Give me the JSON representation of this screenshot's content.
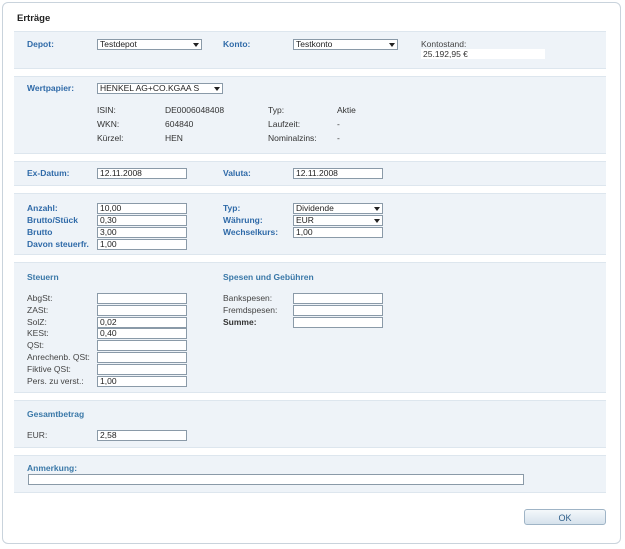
{
  "window": {
    "title": "Erträge"
  },
  "depot": {
    "label": "Depot:",
    "value": "Testdepot"
  },
  "konto": {
    "label": "Konto:",
    "value": "Testkonto"
  },
  "kontostand": {
    "label": "Kontostand:",
    "value": "25.192,95 €"
  },
  "wertpapier": {
    "label": "Wertpapier:",
    "value": "HENKEL AG+CO.KGAA S",
    "isin_label": "ISIN:",
    "isin": "DE0006048408",
    "wkn_label": "WKN:",
    "wkn": "604840",
    "kuerzel_label": "Kürzel:",
    "kuerzel": "HEN",
    "typ_label": "Typ:",
    "typ": "Aktie",
    "laufzeit_label": "Laufzeit:",
    "laufzeit": "-",
    "nominalzins_label": "Nominalzins:",
    "nominalzins": "-"
  },
  "dates": {
    "ex_label": "Ex-Datum:",
    "ex_value": "12.11.2008",
    "valuta_label": "Valuta:",
    "valuta_value": "12.11.2008"
  },
  "amounts": {
    "anzahl_label": "Anzahl:",
    "anzahl": "10,00",
    "brutto_stueck_label": "Brutto/Stück",
    "brutto_stueck": "0,30",
    "brutto_label": "Brutto",
    "brutto": "3,00",
    "steuerfr_label": "Davon steuerfr.",
    "steuerfr": "1,00",
    "typ_label": "Typ:",
    "typ": "Dividende",
    "waehrung_label": "Währung:",
    "waehrung": "EUR",
    "wechselkurs_label": "Wechselkurs:",
    "wechselkurs": "1,00"
  },
  "steuern": {
    "heading": "Steuern",
    "rows": [
      {
        "label": "AbgSt:",
        "value": ""
      },
      {
        "label": "ZASt:",
        "value": ""
      },
      {
        "label": "SolZ:",
        "value": "0,02"
      },
      {
        "label": "KESt:",
        "value": "0,40"
      },
      {
        "label": "QSt:",
        "value": ""
      },
      {
        "label": "Anrechenb. QSt:",
        "value": ""
      },
      {
        "label": "Fiktive QSt:",
        "value": ""
      },
      {
        "label": "Pers. zu verst.:",
        "value": "1,00"
      }
    ]
  },
  "spesen": {
    "heading": "Spesen und Gebühren",
    "bank_label": "Bankspesen:",
    "bank": "",
    "fremd_label": "Fremdspesen:",
    "fremd": "",
    "summe_label": "Summe:",
    "summe": ""
  },
  "gesamt": {
    "heading": "Gesamtbetrag",
    "eur_label": "EUR:",
    "eur": "2,58"
  },
  "anmerkung": {
    "label": "Anmerkung:",
    "value": ""
  },
  "ok_label": "OK"
}
